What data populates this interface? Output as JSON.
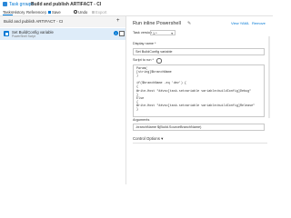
{
  "header": {
    "group_label": "Task groups",
    "separator": "›",
    "title": "Build and publish ARTIFACT - CI"
  },
  "tabs": [
    {
      "label": "Tasks",
      "active": true
    },
    {
      "label": "History",
      "active": false
    },
    {
      "label": "References",
      "active": false
    }
  ],
  "toolbar": {
    "save_label": "Save",
    "undo_label": "Undo",
    "export_label": "Export"
  },
  "left_panel": {
    "group_title": "Build and publish ARTIFACT - CI",
    "add_symbol": "+",
    "task": {
      "name": "Set BuildConfig variable",
      "subtitle": "PowerShell Script"
    }
  },
  "right_panel": {
    "heading": "Run inline Powershell",
    "view_yaml": "View YAML",
    "remove": "Remove",
    "version_label": "Task version",
    "version_value": "1.*",
    "display_name_label": "Display name *",
    "display_name_value": "Set BuildConfig variable",
    "script_label": "Script to run *",
    "script_lines": [
      "Param(",
      "[string]$branchName",
      ")",
      "",
      "if($branchName -eq 'dev') {",
      "{",
      "Write-Host \"##vso[task.setvariable variable=buildConfig]Debug\"",
      "}",
      "Else",
      "{",
      "Write-Host \"##vso[task.setvariable variable=buildConfig]Release\"",
      "}"
    ],
    "arguments_label": "Arguments",
    "arguments_value": "-branchName $(Build.SourceBranchName)",
    "control_options": "Control Options"
  }
}
